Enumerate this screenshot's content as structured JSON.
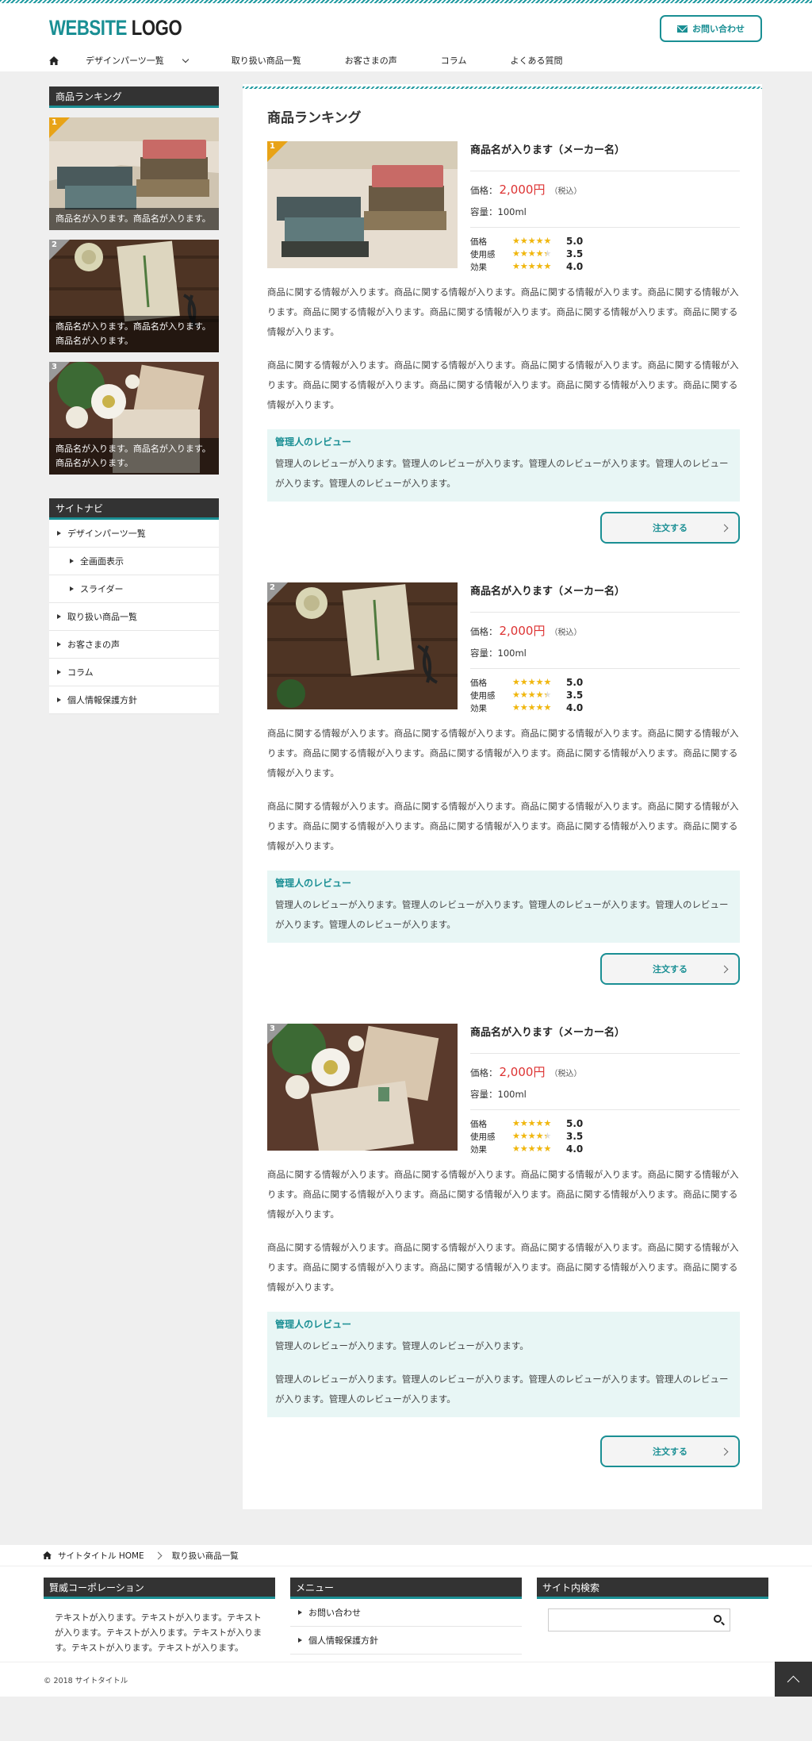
{
  "header": {
    "logo_accent": "WEBSITE",
    "logo_rest": " LOGO",
    "contact_label": "お問い合わせ",
    "nav": [
      "デザインパーツ一覧",
      "取り扱い商品一覧",
      "お客さまの声",
      "コラム",
      "よくある質問"
    ]
  },
  "sidebar": {
    "ranking_title": "商品ランキング",
    "ranking": [
      {
        "num": "1",
        "caption": "商品名が入ります。商品名が入ります。"
      },
      {
        "num": "2",
        "caption": "商品名が入ります。商品名が入ります。商品名が入ります。"
      },
      {
        "num": "3",
        "caption": "商品名が入ります。商品名が入ります。商品名が入ります。"
      }
    ],
    "nav_title": "サイトナビ",
    "nav": [
      "デザインパーツ一覧",
      "全画面表示",
      "スライダー",
      "取り扱い商品一覧",
      "お客さまの声",
      "コラム",
      "個人情報保護方針"
    ]
  },
  "main": {
    "title": "商品ランキング",
    "price_label": "価格：",
    "tax_label": "（税込）",
    "volume_label": "容量：",
    "rating_labels": [
      "価格",
      "使用感",
      "効果"
    ],
    "review_title": "管理人のレビュー",
    "order_label": "注文する",
    "products": [
      {
        "num": "1",
        "name": "商品名が入ります（メーカー名）",
        "price": "2,000円",
        "volume": "100ml",
        "ratings": [
          5.0,
          3.5,
          4.0
        ],
        "rating_texts": [
          "5.0",
          "3.5",
          "4.0"
        ],
        "para1": "商品に関する情報が入ります。商品に関する情報が入ります。商品に関する情報が入ります。商品に関する情報が入ります。商品に関する情報が入ります。商品に関する情報が入ります。商品に関する情報が入ります。商品に関する情報が入ります。",
        "para2": "商品に関する情報が入ります。商品に関する情報が入ります。商品に関する情報が入ります。商品に関する情報が入ります。商品に関する情報が入ります。商品に関する情報が入ります。商品に関する情報が入ります。商品に関する情報が入ります。",
        "review": [
          "管理人のレビューが入ります。管理人のレビューが入ります。管理人のレビューが入ります。管理人のレビューが入ります。管理人のレビューが入ります。"
        ]
      },
      {
        "num": "2",
        "name": "商品名が入ります（メーカー名）",
        "price": "2,000円",
        "volume": "100ml",
        "ratings": [
          5.0,
          3.5,
          4.0
        ],
        "rating_texts": [
          "5.0",
          "3.5",
          "4.0"
        ],
        "para1": "商品に関する情報が入ります。商品に関する情報が入ります。商品に関する情報が入ります。商品に関する情報が入ります。商品に関する情報が入ります。商品に関する情報が入ります。商品に関する情報が入ります。商品に関する情報が入ります。",
        "para2": "商品に関する情報が入ります。商品に関する情報が入ります。商品に関する情報が入ります。商品に関する情報が入ります。商品に関する情報が入ります。商品に関する情報が入ります。商品に関する情報が入ります。商品に関する情報が入ります。",
        "review": [
          "管理人のレビューが入ります。管理人のレビューが入ります。管理人のレビューが入ります。管理人のレビューが入ります。管理人のレビューが入ります。"
        ]
      },
      {
        "num": "3",
        "name": "商品名が入ります（メーカー名）",
        "price": "2,000円",
        "volume": "100ml",
        "ratings": [
          5.0,
          3.5,
          4.0
        ],
        "rating_texts": [
          "5.0",
          "3.5",
          "4.0"
        ],
        "para1": "商品に関する情報が入ります。商品に関する情報が入ります。商品に関する情報が入ります。商品に関する情報が入ります。商品に関する情報が入ります。商品に関する情報が入ります。商品に関する情報が入ります。商品に関する情報が入ります。",
        "para2": "商品に関する情報が入ります。商品に関する情報が入ります。商品に関する情報が入ります。商品に関する情報が入ります。商品に関する情報が入ります。商品に関する情報が入ります。商品に関する情報が入ります。商品に関する情報が入ります。",
        "review": [
          "管理人のレビューが入ります。管理人のレビューが入ります。",
          "管理人のレビューが入ります。管理人のレビューが入ります。管理人のレビューが入ります。管理人のレビューが入ります。管理人のレビューが入ります。"
        ]
      }
    ]
  },
  "breadcrumb": {
    "home": "サイトタイトル HOME",
    "current": "取り扱い商品一覧"
  },
  "footer": {
    "company_title": "賢威コーポレーション",
    "company_text": "テキストが入ります。テキストが入ります。テキストが入ります。テキストが入ります。テキストが入ります。テキストが入ります。テキストが入ります。",
    "menu_title": "メニュー",
    "menu": [
      "お問い合わせ",
      "個人情報保護方針"
    ],
    "search_title": "サイト内検索",
    "search_placeholder": "",
    "copyright": "© 2018 サイトタイトル"
  },
  "colors": {
    "accent": "#1a8f94",
    "price": "#dd3333",
    "star": "#f2b70b",
    "rank1": "#e8a317",
    "rank_other": "#999999"
  }
}
